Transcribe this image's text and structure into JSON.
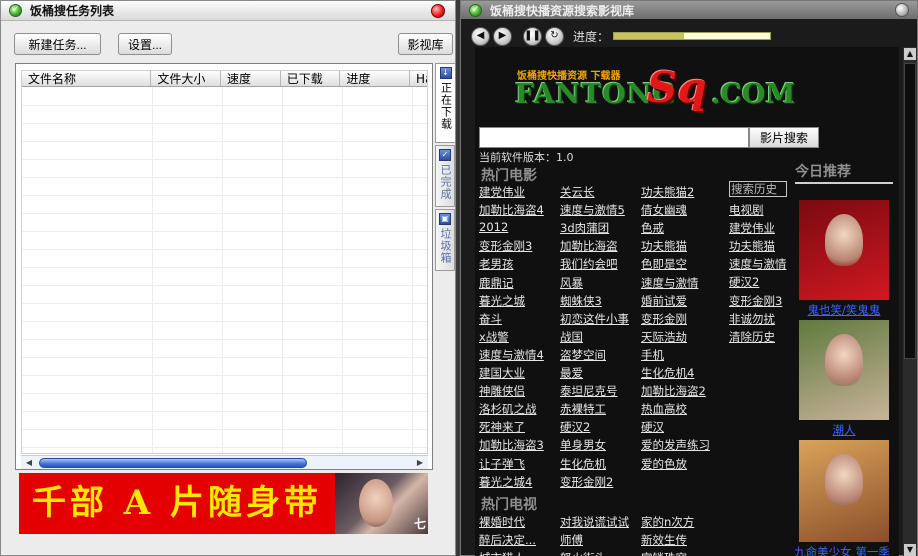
{
  "left_window": {
    "title": "饭桶搜任务列表",
    "buttons": {
      "new_task": "新建任务...",
      "settings": "设置...",
      "library": "影视库"
    },
    "columns": [
      "文件名称",
      "文件大小",
      "速度",
      "已下载",
      "进度",
      "Ha"
    ],
    "tabs": [
      "正在下载",
      "已完成",
      "垃圾箱"
    ],
    "banner": {
      "text": "千部 A 片随身带",
      "photo_text": "七"
    }
  },
  "right_window": {
    "title": "饭桶搜快播资源搜索影视库",
    "progress_label": "进度：",
    "progress": 0.45,
    "logo": {
      "small": "饭桶搜快播资源 下载器",
      "fantong": "FANTONG",
      "sq": "Sq",
      "com": ".COM"
    },
    "search_button": "影片搜索",
    "version": "当前软件版本：1.0",
    "hot_movies_title": "热门电影",
    "hot_movies": [
      [
        "建党伟业",
        "关云长",
        "功夫熊猫2"
      ],
      [
        "加勒比海盗4",
        "速度与激情5",
        "倩女幽魂"
      ],
      [
        "2012",
        "3d肉蒲团",
        "色戒"
      ],
      [
        "变形金刚3",
        "加勒比海盗",
        "功夫熊猫"
      ],
      [
        "老男孩",
        "我们约会吧",
        "色即是空"
      ],
      [
        "鹿鼎记",
        "风暴",
        "速度与激情"
      ],
      [
        "暮光之城",
        "蜘蛛侠3",
        "婚前试爱"
      ],
      [
        "奋斗",
        "初恋这件小事",
        "变形金刚"
      ],
      [
        "x战警",
        "战国",
        "天际浩劫"
      ],
      [
        "速度与激情4",
        "盗梦空间",
        "手机"
      ],
      [
        "建国大业",
        "最爱",
        "生化危机4"
      ],
      [
        "神雕侠侣",
        "泰坦尼克号",
        "加勒比海盗2"
      ],
      [
        "洛杉矶之战",
        "赤裸特工",
        "热血高校"
      ],
      [
        "死神来了",
        "硬汉2",
        "硬汉"
      ],
      [
        "加勒比海盗3",
        "单身男女",
        "爱的发声练习"
      ],
      [
        "让子弹飞",
        "生化危机",
        "爱的色放"
      ],
      [
        "暮光之城4",
        "变形金刚2",
        ""
      ]
    ],
    "hot_tv_title": "热门电视",
    "hot_tv": [
      [
        "裸婚时代",
        "对我说谎试试",
        "家的n次方"
      ],
      [
        "醉后决定...",
        "师傅",
        "新效生传"
      ],
      [
        "城市猎人",
        "怒火街头",
        "宫锁珠帘"
      ]
    ],
    "history": {
      "title": "搜索历史",
      "items": [
        "电视剧",
        "建党伟业",
        "功夫熊猫",
        "速度与激情",
        "硬汉2",
        "变形金刚3",
        "非诚勿扰",
        "清除历史"
      ]
    },
    "today": {
      "title": "今日推荐",
      "posters": [
        {
          "caption": "鬼也笑/笑鬼鬼",
          "colors": [
            "#7a0a10",
            "#d11822"
          ]
        },
        {
          "caption": "潮人",
          "colors": [
            "#5f7a3e",
            "#c9b39a"
          ]
        },
        {
          "caption": "九命美少女 第一季",
          "colors": [
            "#d9a35a",
            "#8a4f2a"
          ]
        }
      ]
    }
  }
}
